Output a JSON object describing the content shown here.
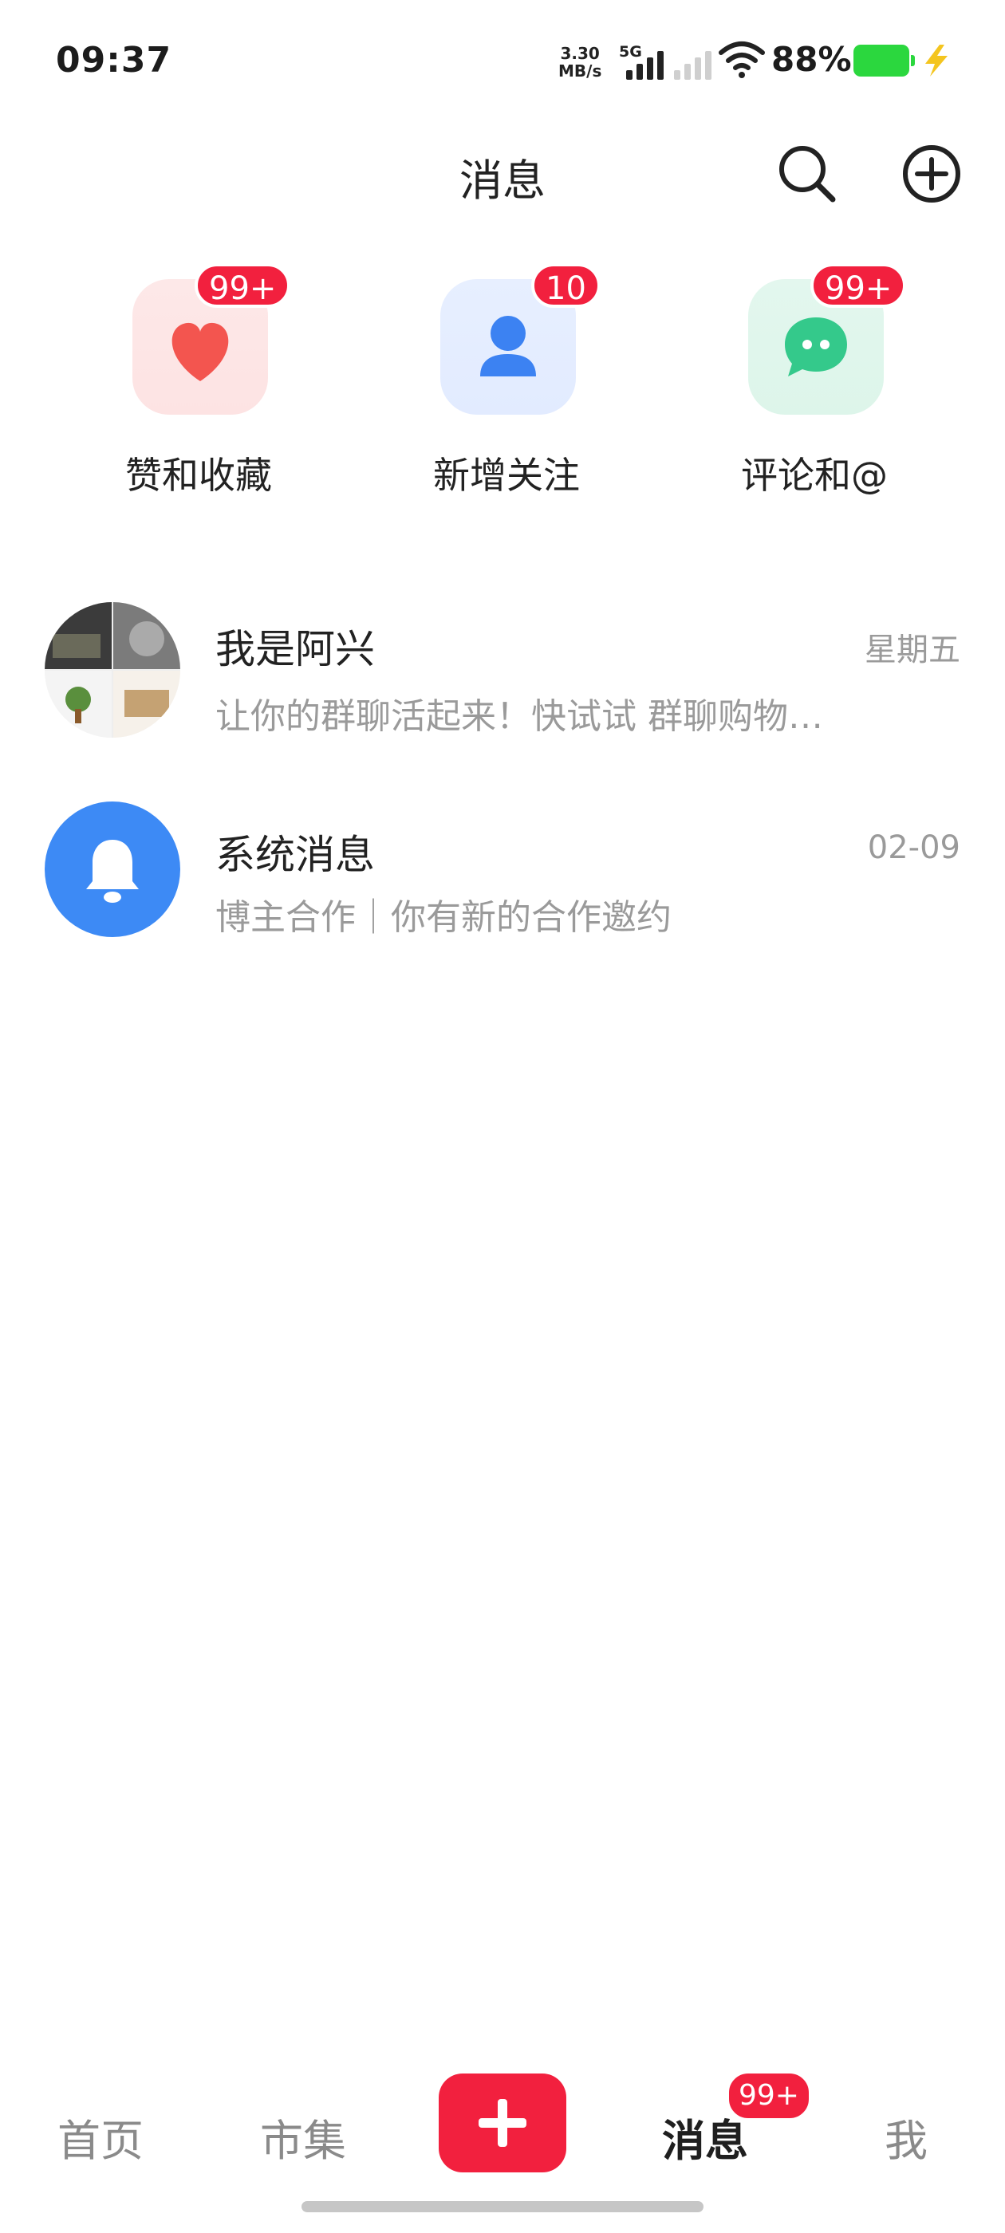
{
  "status_bar": {
    "time": "09:37",
    "net_speed_value": "3.30",
    "net_speed_unit": "MB/s",
    "network_type": "5G",
    "battery_percent": "88%"
  },
  "header": {
    "title": "消息",
    "search_icon": "search-icon",
    "add_icon": "plus-circle-icon"
  },
  "quick_actions": [
    {
      "label": "赞和收藏",
      "badge": "99+",
      "icon": "heart-icon",
      "color": "#f3554f"
    },
    {
      "label": "新增关注",
      "badge": "10",
      "icon": "person-icon",
      "color": "#3c82f2"
    },
    {
      "label": "评论和@",
      "badge": "99+",
      "icon": "chat-bubble-icon",
      "color": "#34c98b"
    }
  ],
  "messages": [
    {
      "name": "我是阿兴",
      "time": "星期五",
      "preview": "让你的群聊活起来！快试试 群聊购物…"
    },
    {
      "name": "系统消息",
      "time": "02-09",
      "preview": "博主合作｜你有新的合作邀约"
    }
  ],
  "tab_bar": {
    "tabs": [
      "首页",
      "市集",
      "消息",
      "我"
    ],
    "active": "消息",
    "messages_badge": "99+"
  },
  "colors": {
    "accent": "#f2203e",
    "system_blue": "#3d8af5"
  }
}
